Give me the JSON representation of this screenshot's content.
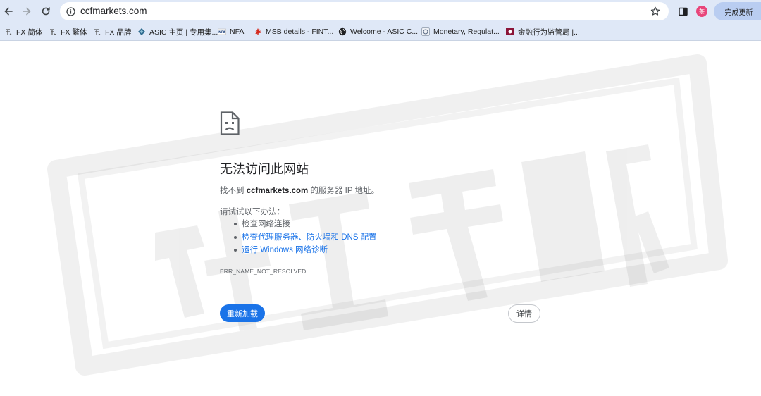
{
  "toolbar": {
    "url": "ccfmarkets.com",
    "update_label": "完成更新",
    "profile_initial": "茶"
  },
  "bookmarks": [
    {
      "label": "FX 简体",
      "icon": "fx-icon"
    },
    {
      "label": "FX 繁体",
      "icon": "fx-icon"
    },
    {
      "label": "FX 品牌",
      "icon": "fx-icon"
    },
    {
      "label": "ASIC 主页 | 专用集...",
      "icon": "asic-icon"
    },
    {
      "label": "NFA",
      "icon": "nfa-icon"
    },
    {
      "label": "MSB details - FINT...",
      "icon": "maple-leaf-icon"
    },
    {
      "label": "Welcome - ASIC C...",
      "icon": "globe-icon"
    },
    {
      "label": "Monetary, Regulat...",
      "icon": "mas-icon"
    },
    {
      "label": "金融行为监管局 |...",
      "icon": "fca-icon"
    }
  ],
  "error": {
    "title": "无法访问此网站",
    "desc_prefix": "找不到 ",
    "domain": "ccfmarkets.com",
    "desc_suffix": " 的服务器 IP 地址。",
    "try_label": "请试试以下办法：",
    "suggestions": [
      {
        "text": "检查网络连接",
        "link": false
      },
      {
        "text": "检查代理服务器、防火墙和 DNS 配置",
        "link": true
      },
      {
        "text": "运行 Windows 网络诊断",
        "link": true
      }
    ],
    "code": "ERR_NAME_NOT_RESOLVED",
    "reload_label": "重新加载",
    "details_label": "详情"
  },
  "colors": {
    "chrome_bg": "#dfe8f7",
    "link_blue": "#1a73e8",
    "update_pill": "#b9cdf1"
  }
}
